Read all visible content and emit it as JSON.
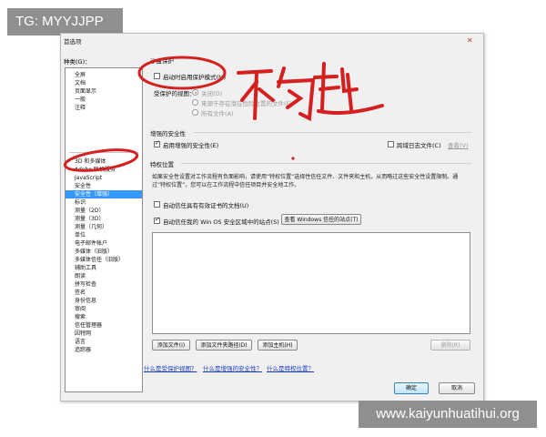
{
  "overlay": {
    "tag": "TG: MYYJJPP",
    "watermark": "www.kaiyunhuatihui.org",
    "handwritten": "不勾选"
  },
  "dialog": {
    "title": "首选项",
    "close_icon": "close-icon",
    "categories_label": "种类(G)：",
    "categories_group1": [
      "全屏",
      "文档",
      "页面显示",
      "一般",
      "注释"
    ],
    "categories_group2": [
      "3D 和多媒体",
      "Adobe 联机服务",
      "JavaScript",
      "安全性",
      "安全性（增强）",
      "标识",
      "测量（2D）",
      "测量（3D）",
      "测量（几何）",
      "单位",
      "电子邮件帐户",
      "多媒体（旧版）",
      "多媒体信任（旧版）",
      "辅助工具",
      "朗读",
      "拼写检查",
      "签名",
      "身份信息",
      "审阅",
      "搜索",
      "信任管理器",
      "因特网",
      "语言",
      "追踪器"
    ],
    "selected_category": "安全性（增强）",
    "sandbox": {
      "heading": "沙盒保护",
      "enable_protected_mode": "启动时启用保护模式(M)",
      "protected_view_label": "受保护的视图：",
      "radio_off": "关闭(O)",
      "radio_unsafe": "来源于存在潜在危险位置的文件(F)",
      "radio_all": "所有文件(A)"
    },
    "enhanced": {
      "heading": "增强的安全性",
      "enable_enhanced": "启用增强的安全性(E)",
      "cross_domain_log": "跨域日志文件(C)",
      "view_link": "查看(V)"
    },
    "privileged": {
      "heading": "特权位置",
      "description": "如果安全性设置对工作流程有负面影响，请使用“特权位置”选择性信任文件、文件夹和主机，从而略过这些安全性设置限制。通过“特权位置”，您可以在工作流程中信任项目并安全地工作。",
      "auto_trust_certified": "自动信任具有有效证书的文档(U)",
      "auto_trust_win_sites": "自动信任我的 Win OS 安全区域中的站点(S)",
      "view_windows_sites": "查看 Windows 信任的站点(T)",
      "add_file": "添加文件(I)",
      "add_folder": "添加文件夹路径(D)",
      "add_host": "添加主机(H)",
      "remove": "删除(R)"
    },
    "links": [
      "什么是受保护视图？",
      "什么是增强的安全性？",
      "什么是特权位置？"
    ],
    "ok": "确定",
    "cancel": "取消"
  },
  "colors": {
    "selection": "#3399ff",
    "annotation": "#d61f1f",
    "link": "#1a3ec9"
  }
}
